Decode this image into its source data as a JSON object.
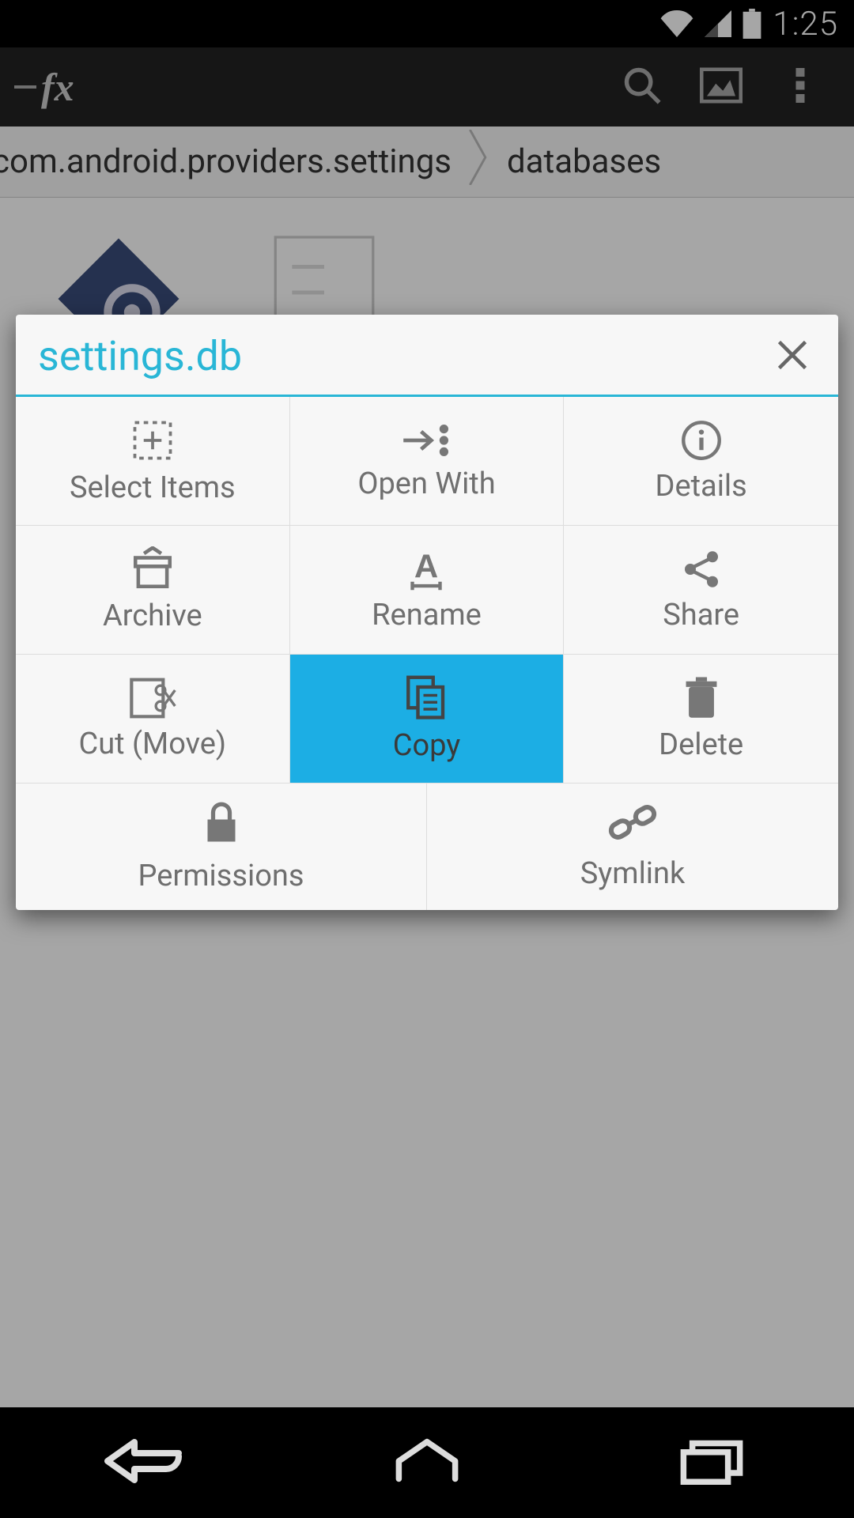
{
  "statusbar": {
    "time": "1:25"
  },
  "toolbar": {
    "brand": "fx"
  },
  "breadcrumb": {
    "segments": [
      "com.android.providers.settings",
      "databases"
    ]
  },
  "dialog": {
    "title": "settings.db",
    "actions": [
      {
        "id": "select-items",
        "label": "Select Items",
        "selected": false
      },
      {
        "id": "open-with",
        "label": "Open With",
        "selected": false
      },
      {
        "id": "details",
        "label": "Details",
        "selected": false
      },
      {
        "id": "archive",
        "label": "Archive",
        "selected": false
      },
      {
        "id": "rename",
        "label": "Rename",
        "selected": false
      },
      {
        "id": "share",
        "label": "Share",
        "selected": false
      },
      {
        "id": "cut",
        "label": "Cut (Move)",
        "selected": false
      },
      {
        "id": "copy",
        "label": "Copy",
        "selected": true
      },
      {
        "id": "delete",
        "label": "Delete",
        "selected": false
      }
    ],
    "actions_row2": [
      {
        "id": "permissions",
        "label": "Permissions"
      },
      {
        "id": "symlink",
        "label": "Symlink"
      }
    ]
  }
}
